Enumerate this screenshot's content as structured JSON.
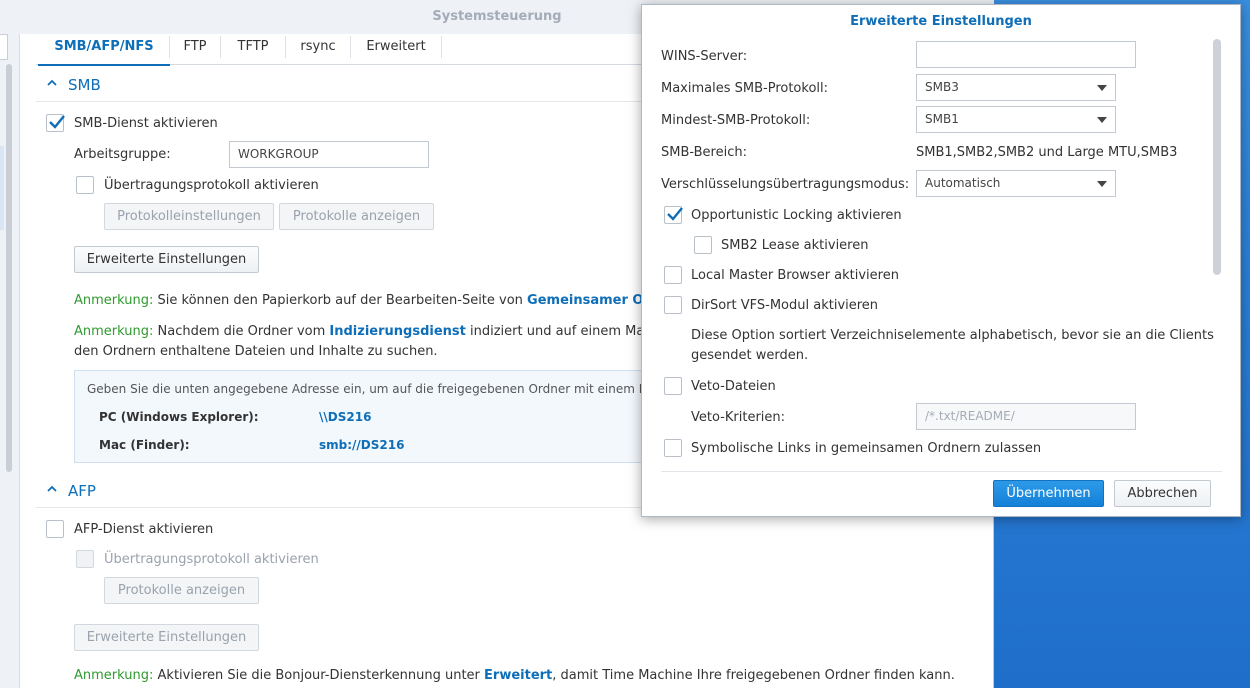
{
  "window": {
    "title": "Systemsteuerung"
  },
  "tabs": [
    {
      "label": "SMB/AFP/NFS",
      "active": true
    },
    {
      "label": "FTP"
    },
    {
      "label": "TFTP"
    },
    {
      "label": "rsync"
    },
    {
      "label": "Erweitert"
    }
  ],
  "smb": {
    "section_title": "SMB",
    "enable_label": "SMB-Dienst aktivieren",
    "enable_checked": true,
    "workgroup_label": "Arbeitsgruppe:",
    "workgroup_value": "WORKGROUP",
    "transfer_log_label": "Übertragungsprotokoll aktivieren",
    "log_settings_button": "Protokolleinstellungen",
    "show_logs_button": "Protokolle anzeigen",
    "advanced_button": "Erweiterte Einstellungen",
    "note1": {
      "label": "Anmerkung:",
      "text": " Sie können den Papierkorb auf der Bearbeiten-Seite von ",
      "link": "Gemeinsamer Ordn"
    },
    "note2": {
      "label": "Anmerkung:",
      "text_a": " Nachdem die Ordner vom ",
      "link": "Indizierungsdienst",
      "text_b": " indiziert und auf einem Mac ang",
      "line2": "den Ordnern enthaltene Dateien und Inhalte zu suchen."
    },
    "info": {
      "intro": "Geben Sie die unten angegebene Adresse ein, um auf die freigegebenen Ordner mit einem PC in",
      "pc_label": "PC (Windows Explorer):",
      "pc_value": "\\\\DS216",
      "mac_label": "Mac (Finder):",
      "mac_value": "smb://DS216"
    }
  },
  "afp": {
    "section_title": "AFP",
    "enable_label": "AFP-Dienst aktivieren",
    "transfer_log_label": "Übertragungsprotokoll aktivieren",
    "show_logs_button": "Protokolle anzeigen",
    "advanced_button": "Erweiterte Einstellungen",
    "note": {
      "label": "Anmerkung:",
      "text_a": " Aktivieren Sie die Bonjour-Diensterkennung unter ",
      "link": "Erweitert",
      "text_b": ", damit Time Machine Ihre freigegebenen Ordner finden kann."
    }
  },
  "dialog": {
    "title": "Erweiterte Einstellungen",
    "wins_label": "WINS-Server:",
    "wins_value": "",
    "max_proto_label": "Maximales SMB-Protokoll:",
    "max_proto_value": "SMB3",
    "min_proto_label": "Mindest-SMB-Protokoll:",
    "min_proto_value": "SMB1",
    "range_label": "SMB-Bereich:",
    "range_value": "SMB1,SMB2,SMB2 und Large MTU,SMB3",
    "encryption_label": "Verschlüsselungsübertragungsmodus:",
    "encryption_value": "Automatisch",
    "oplock_label": "Opportunistic Locking aktivieren",
    "oplock_checked": true,
    "smb2_lease_label": "SMB2 Lease aktivieren",
    "local_master_label": "Local Master Browser aktivieren",
    "dirsort_label": "DirSort VFS-Modul aktivieren",
    "dirsort_desc_1": "Diese Option sortiert Verzeichniselemente alphabetisch, bevor sie an die Clients",
    "dirsort_desc_2": "gesendet werden.",
    "veto_label": "Veto-Dateien",
    "veto_criteria_label": "Veto-Kriterien:",
    "veto_criteria_placeholder": "/*.txt/README/",
    "symlinks_label": "Symbolische Links in gemeinsamen Ordnern zulassen",
    "apply_button": "Übernehmen",
    "cancel_button": "Abbrechen"
  },
  "colors": {
    "accent": "#0e6eb8",
    "note_label": "#2f9a2f",
    "desktop": "#2b7fd6"
  }
}
